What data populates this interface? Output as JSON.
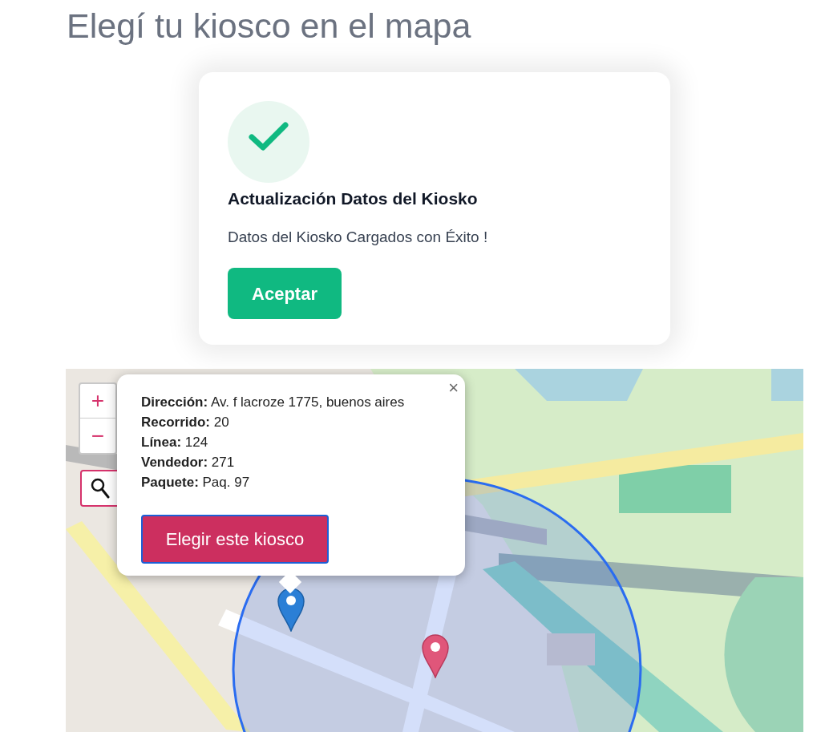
{
  "heading": "Elegí tu kiosco en el mapa",
  "dialog": {
    "title": "Actualización Datos del Kiosko",
    "message": "Datos del Kiosko Cargados con Éxito !",
    "button": "Aceptar"
  },
  "map": {
    "zoom_in": "+",
    "zoom_out": "−",
    "popup": {
      "close": "×",
      "lines": [
        "**Dirección:** Av. f lacroze 1775, buenos aires",
        "**Recorrido:** 20",
        "**Línea:** 124",
        "**Vendedor:** 271",
        "**Paquete:** Paq. 97"
      ],
      "button": "Elegir este kiosco"
    }
  }
}
